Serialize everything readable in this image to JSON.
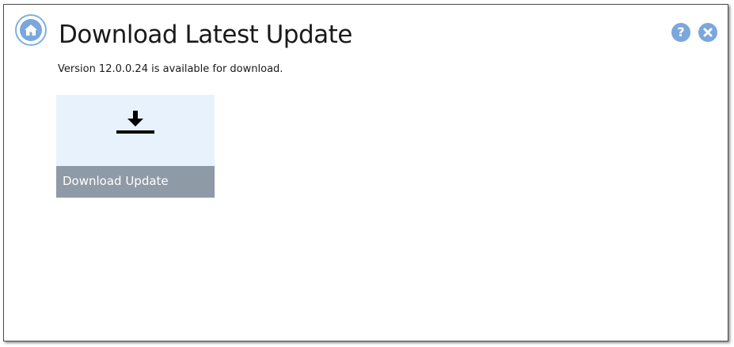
{
  "header": {
    "title": "Download Latest Update",
    "home_icon": "home-icon",
    "help_icon": "help-icon",
    "help_glyph": "?",
    "close_icon": "close-icon"
  },
  "main": {
    "version_message": "Version 12.0.0.24 is available for download.",
    "download_tile": {
      "label": "Download Update",
      "icon": "download-icon"
    }
  },
  "colors": {
    "accent": "#7aa7dc",
    "tile_top": "#e7f2fd",
    "tile_bottom": "#8e9aa6"
  }
}
